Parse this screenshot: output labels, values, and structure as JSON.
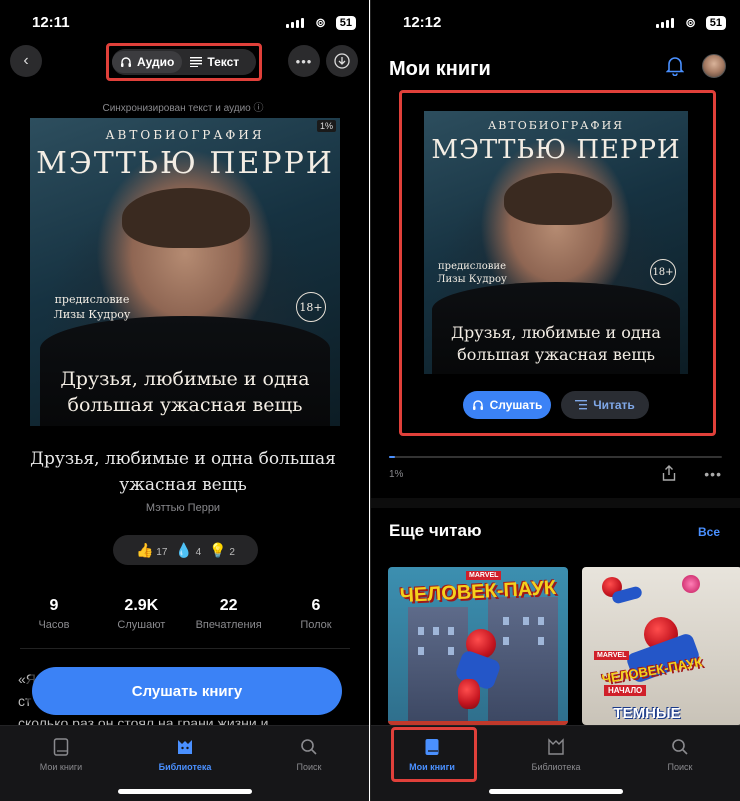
{
  "left": {
    "status": {
      "time": "12:11",
      "battery": "51"
    },
    "toggle": {
      "audio": "Аудио",
      "text": "Текст"
    },
    "sync_note": "Синхронизирован текст и аудио ⓘ",
    "cover": {
      "top": "АВТОБИОГРАФИЯ",
      "author": "МЭТТЬЮ ПЕРРИ",
      "foreword_1": "предисловие",
      "foreword_2": "Лизы Кудроу",
      "age": "18+",
      "title_1": "Друзья, любимые и одна",
      "title_2": "большая ужасная вещь",
      "progress": "1%"
    },
    "book_title": "Друзья, любимые и одна большая ужасная вещь",
    "book_author": "Мэттью Перри",
    "reactions": [
      {
        "icon": "👍",
        "count": "17"
      },
      {
        "icon": "💧",
        "count": "4"
      },
      {
        "icon": "💡",
        "count": "2"
      }
    ],
    "stats": [
      {
        "value": "9",
        "label": "Часов"
      },
      {
        "value": "2.9K",
        "label": "Слушают"
      },
      {
        "value": "22",
        "label": "Впечатления"
      },
      {
        "value": "6",
        "label": "Полок"
      }
    ],
    "excerpt_1": "«Я",
    "excerpt_2": "ст",
    "excerpt_3": "сколько раз он стоял на грани жизни и",
    "listen_button": "Слушать книгу",
    "tabs": [
      {
        "label": "Мои книги",
        "icon": "book-icon"
      },
      {
        "label": "Библиотека",
        "icon": "library-icon"
      },
      {
        "label": "Поиск",
        "icon": "search-icon"
      }
    ]
  },
  "right": {
    "status": {
      "time": "12:12",
      "battery": "51"
    },
    "title": "Мои книги",
    "cover": {
      "top": "АВТОБИОГРАФИЯ",
      "author": "МЭТТЬЮ ПЕРРИ",
      "foreword_1": "предисловие",
      "foreword_2": "Лизы Кудроу",
      "age": "18+",
      "title_1": "Друзья, любимые и одна",
      "title_2": "большая ужасная вещь"
    },
    "listen": "Слушать",
    "read": "Читать",
    "progress_label": "1%",
    "progress_value": 0.01,
    "section_title": "Еще читаю",
    "all_link": "Все",
    "comic1": {
      "brand": "MARVEL",
      "title": "ЧЕЛОВЕК-ПАУК"
    },
    "comic2": {
      "brand": "MARVEL",
      "title_1": "ЧЕЛОВЕК-ПАУК",
      "subtitle": "НАЧАЛО",
      "title_2": "ТЕМНЫЕ"
    },
    "tabs": [
      {
        "label": "Мои книги",
        "icon": "book-icon"
      },
      {
        "label": "Библиотека",
        "icon": "library-icon"
      },
      {
        "label": "Поиск",
        "icon": "search-icon"
      }
    ]
  },
  "colors": {
    "accent": "#3b82f6",
    "highlight": "#e0403a",
    "background": "#000000"
  }
}
